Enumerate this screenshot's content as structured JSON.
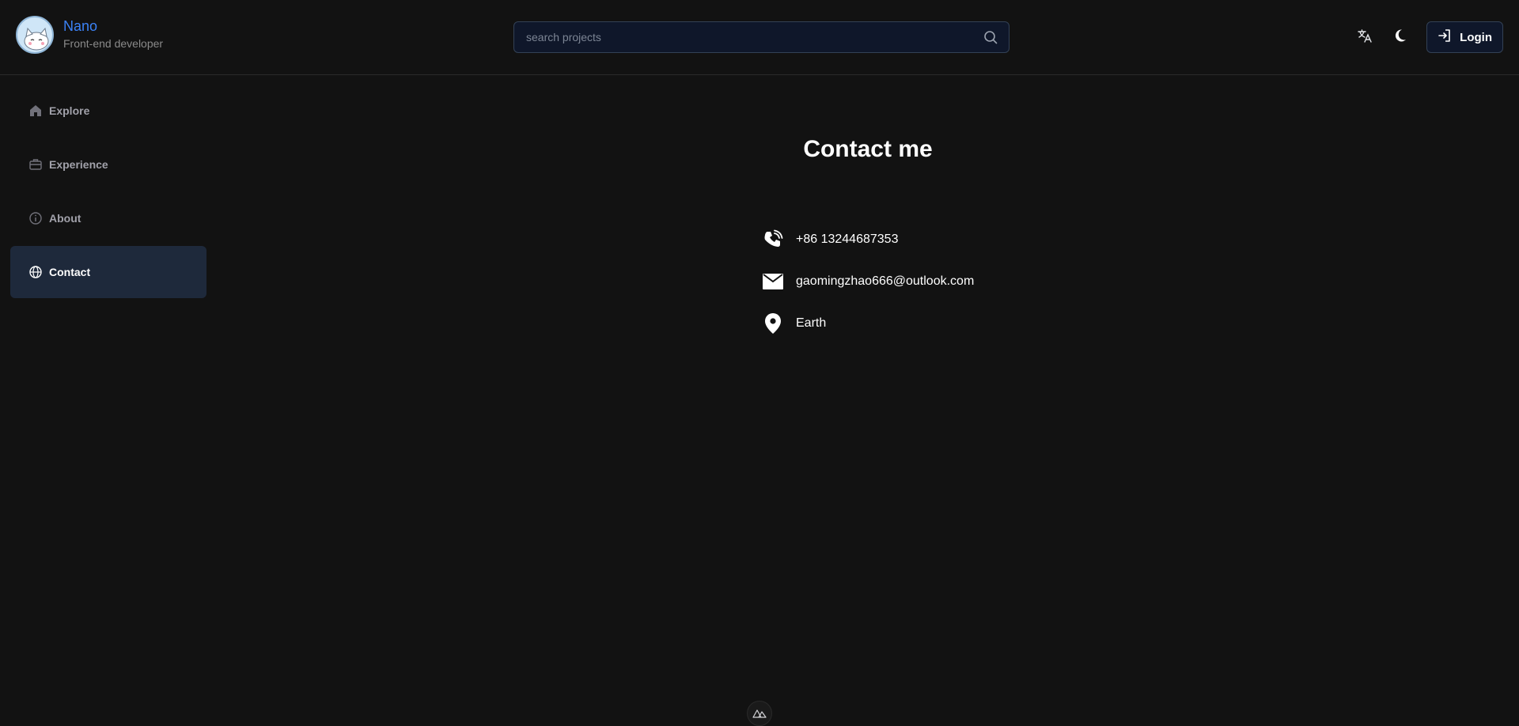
{
  "brand": {
    "name": "Nano",
    "role": "Front-end developer"
  },
  "search": {
    "placeholder": "search projects",
    "value": ""
  },
  "header": {
    "login_label": "Login"
  },
  "sidebar": {
    "items": [
      {
        "label": "Explore",
        "icon": "home-icon"
      },
      {
        "label": "Experience",
        "icon": "briefcase-icon"
      },
      {
        "label": "About",
        "icon": "info-icon"
      },
      {
        "label": "Contact",
        "icon": "globe-icon",
        "active": true
      }
    ]
  },
  "main": {
    "title": "Contact me",
    "contacts": [
      {
        "icon": "phone-icon",
        "text": "+86 13244687353"
      },
      {
        "icon": "mail-icon",
        "text": "gaomingzhao666@outlook.com"
      },
      {
        "icon": "location-pin-icon",
        "text": "Earth"
      }
    ]
  },
  "colors": {
    "background": "#121212",
    "accent": "#3b82f6",
    "active_nav": "#1e293b"
  }
}
